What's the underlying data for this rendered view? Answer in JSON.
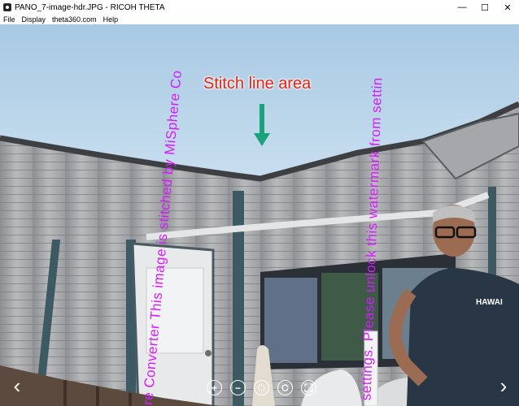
{
  "window": {
    "title": "PANO_7-image-hdr.JPG - RICOH THETA",
    "minimize_glyph": "—",
    "maximize_glyph": "☐",
    "close_glyph": "✕"
  },
  "menu": [
    "File",
    "Display",
    "theta360.com",
    "Help"
  ],
  "annotation": {
    "label": "Stitch line area",
    "label_color": "#e52212",
    "arrow_color": "#1aa37a"
  },
  "watermark": {
    "color": "#d61cff",
    "line1": "re Converter This image is stitched by MiSphere Co",
    "line2": "n settings. Please unlock this watermark from settin"
  },
  "controls": {
    "prev_glyph": "‹",
    "next_glyph": "›",
    "zoom_in_glyph": "+",
    "zoom_out_glyph": "−",
    "icons": [
      "zoom-in-icon",
      "zoom-out-icon",
      "autoplay-icon",
      "rotate-icon",
      "fullscreen-icon"
    ]
  }
}
